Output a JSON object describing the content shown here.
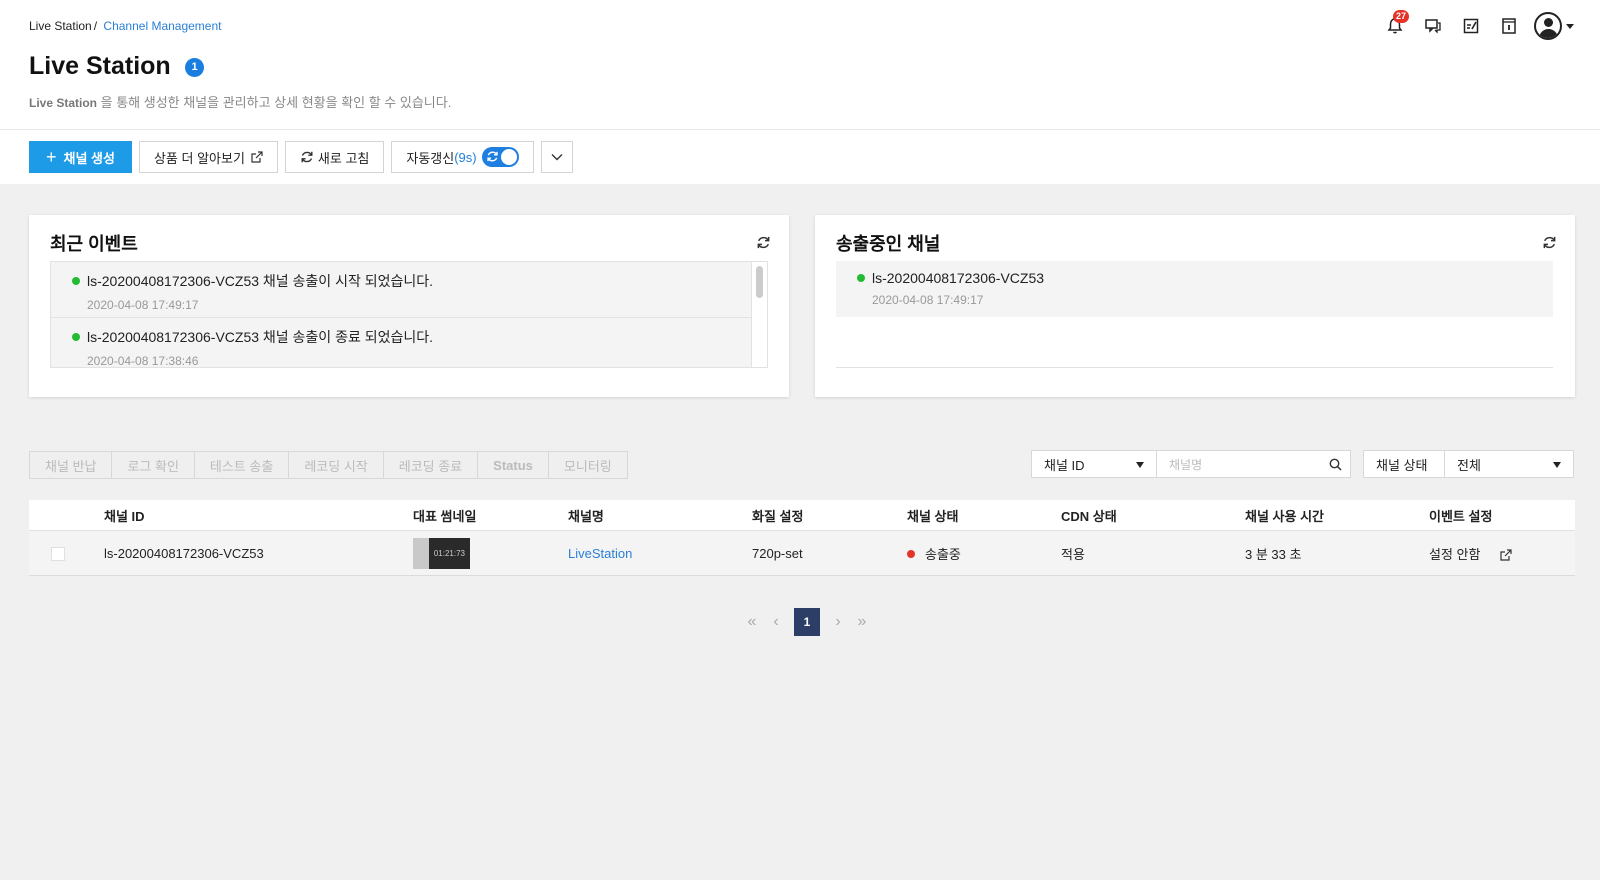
{
  "breadcrumb": {
    "root": "Live Station",
    "separator": "/",
    "current": "Channel Management"
  },
  "header": {
    "title": "Live Station",
    "title_badge": "1",
    "subtitle_bold": "Live Station",
    "subtitle_rest": " 을 통해 생성한 채널을 관리하고 상세 현황을 확인 할 수 있습니다.",
    "notification_count": "27",
    "icons": [
      "bell-icon",
      "chat-icon",
      "memo-icon",
      "info-book-icon",
      "user-avatar"
    ]
  },
  "toolbar": {
    "create_label": "채널 생성",
    "learn_more_label": "상품 더 알아보기",
    "refresh_label": "새로 고침",
    "auto_refresh_label": "자동갱신",
    "auto_refresh_count": "(9s)",
    "auto_refresh_on": true
  },
  "recent_events": {
    "title": "최근 이벤트",
    "items": [
      {
        "text": "ls-20200408172306-VCZ53 채널 송출이 시작 되었습니다.",
        "time": "2020-04-08 17:49:17"
      },
      {
        "text": "ls-20200408172306-VCZ53 채널 송출이 종료 되었습니다.",
        "time": "2020-04-08 17:38:46"
      }
    ]
  },
  "live_channels": {
    "title": "송출중인 채널",
    "items": [
      {
        "text": "ls-20200408172306-VCZ53",
        "time": "2020-04-08 17:49:17"
      }
    ]
  },
  "actions": [
    "채널 반납",
    "로그 확인",
    "테스트 송출",
    "레코딩 시작",
    "레코딩 종료",
    "Status",
    "모니터링"
  ],
  "filters": {
    "search_field": "채널 ID",
    "search_placeholder": "채널명",
    "status_label": "채널 상태",
    "status_value": "전체"
  },
  "table": {
    "headers": [
      "채널 ID",
      "대표 썸네일",
      "채널명",
      "화질 설정",
      "채널 상태",
      "CDN 상태",
      "채널 사용 시간",
      "이벤트 설정"
    ],
    "rows": [
      {
        "channel_id": "ls-20200408172306-VCZ53",
        "thumbnail_text": "01:21:73",
        "channel_name": "LiveStation",
        "quality": "720p-set",
        "status": "송출중",
        "cdn": "적용",
        "usage_time": "3 분 33 초",
        "event": "설정 안함"
      }
    ]
  },
  "pagination": {
    "current": "1"
  },
  "colors": {
    "primary": "#1e9be6",
    "live_green": "#22bb33",
    "live_red": "#e5332a",
    "link": "#2a7fd6",
    "pager_active": "#2c3e66"
  }
}
